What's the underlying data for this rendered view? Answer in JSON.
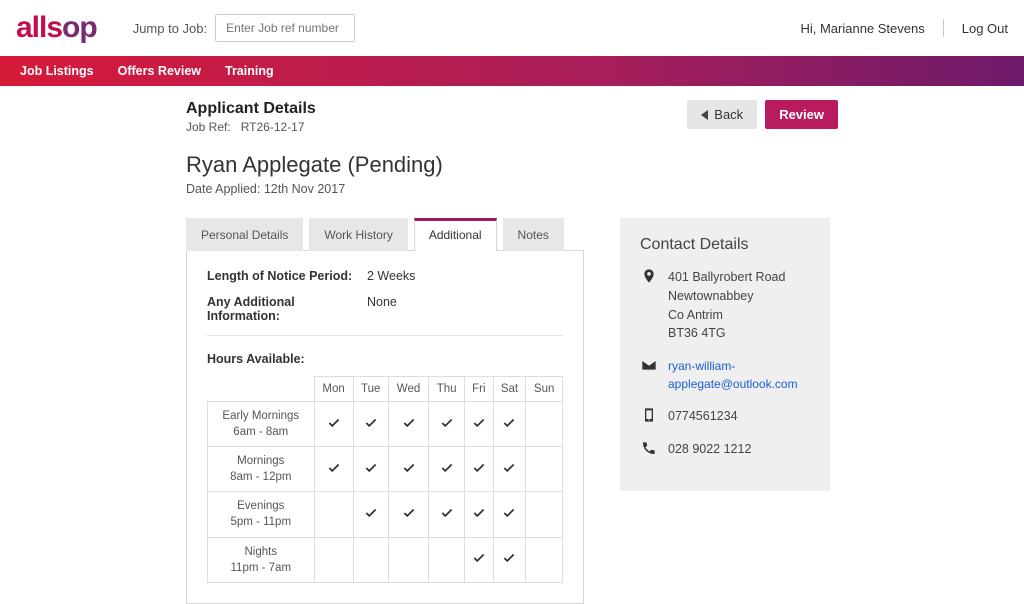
{
  "topbar": {
    "logo_left": "alls",
    "logo_right": "op",
    "jump_label": "Jump to Job:",
    "jump_placeholder": "Enter Job ref number",
    "greeting": "Hi, Marianne Stevens",
    "logout": "Log Out"
  },
  "nav": [
    "Job Listings",
    "Offers Review",
    "Training"
  ],
  "header": {
    "section_title": "Applicant Details",
    "job_ref_label": "Job Ref:",
    "job_ref_value": "RT26-12-17",
    "applicant_name": "Ryan Applegate (Pending)",
    "date_applied_label": "Date Applied:",
    "date_applied_value": "12th Nov 2017",
    "back_label": "Back",
    "review_label": "Review"
  },
  "tabs": [
    "Personal Details",
    "Work History",
    "Additional",
    "Notes"
  ],
  "active_tab_index": 2,
  "additional": {
    "notice_label": "Length of Notice Period:",
    "notice_value": "2 Weeks",
    "info_label": "Any Additional Information:",
    "info_value": "None",
    "hours_title": "Hours Available:",
    "days": [
      "Mon",
      "Tue",
      "Wed",
      "Thu",
      "Fri",
      "Sat",
      "Sun"
    ],
    "slots": [
      {
        "name": "Early Mornings",
        "time": "6am - 8am",
        "avail": [
          true,
          true,
          true,
          true,
          true,
          true,
          false
        ]
      },
      {
        "name": "Mornings",
        "time": "8am - 12pm",
        "avail": [
          true,
          true,
          true,
          true,
          true,
          true,
          false
        ]
      },
      {
        "name": "Evenings",
        "time": "5pm - 11pm",
        "avail": [
          false,
          true,
          true,
          true,
          true,
          true,
          false
        ]
      },
      {
        "name": "Nights",
        "time": "11pm - 7am",
        "avail": [
          false,
          false,
          false,
          false,
          true,
          true,
          false
        ]
      }
    ]
  },
  "contact": {
    "title": "Contact Details",
    "address": [
      "401 Ballyrobert Road",
      "Newtownabbey",
      "Co Antrim",
      "BT36 4TG"
    ],
    "email": "ryan-william-applegate@outlook.com",
    "mobile": "0774561234",
    "landline": "028 9022 1212"
  }
}
